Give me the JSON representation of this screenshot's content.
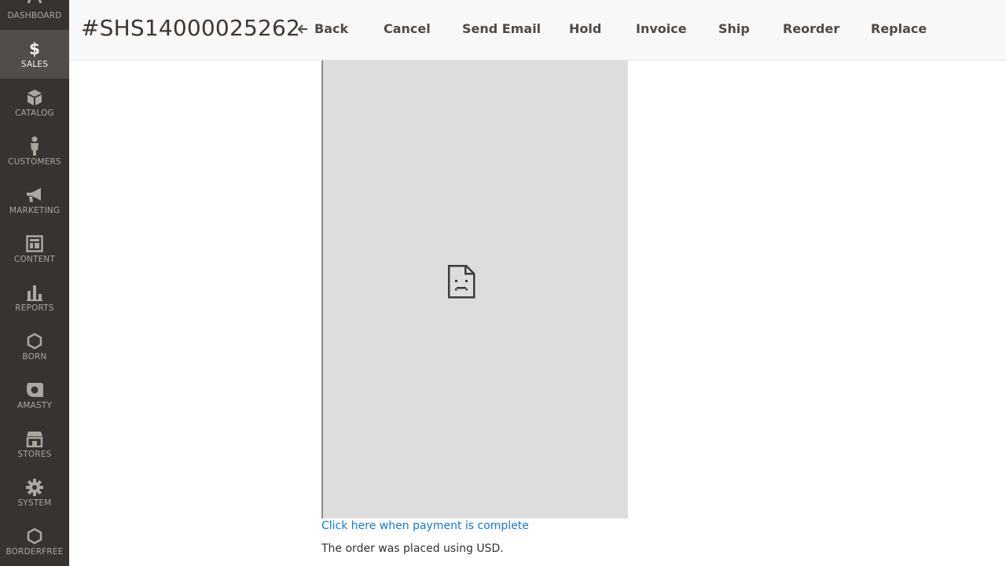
{
  "sidebar": {
    "items": [
      {
        "label": "DASHBOARD",
        "icon": "dashboard-icon",
        "active": false
      },
      {
        "label": "SALES",
        "icon": "dollar-icon",
        "active": true
      },
      {
        "label": "CATALOG",
        "icon": "cube-icon",
        "active": false
      },
      {
        "label": "CUSTOMERS",
        "icon": "person-icon",
        "active": false
      },
      {
        "label": "MARKETING",
        "icon": "megaphone-icon",
        "active": false
      },
      {
        "label": "CONTENT",
        "icon": "layout-icon",
        "active": false
      },
      {
        "label": "REPORTS",
        "icon": "bar-chart-icon",
        "active": false
      },
      {
        "label": "BORN",
        "icon": "hexagon-icon",
        "active": false
      },
      {
        "label": "AMASTY",
        "icon": "amasty-logo-icon",
        "active": false
      },
      {
        "label": "STORES",
        "icon": "storefront-icon",
        "active": false
      },
      {
        "label": "SYSTEM",
        "icon": "gear-icon",
        "active": false
      },
      {
        "label": "BORDERFREE",
        "icon": "hexagon-icon",
        "active": false
      }
    ]
  },
  "header": {
    "order_title": "#SHS14000025262",
    "buttons": {
      "back": "Back",
      "cancel": "Cancel",
      "send_email": "Send Email",
      "hold": "Hold",
      "invoice": "Invoice",
      "ship": "Ship",
      "reorder": "Reorder",
      "replace": "Replace"
    }
  },
  "content": {
    "payment_link": "Click here when payment is complete",
    "currency_note": "The order was placed using USD.",
    "frame_icon": "broken-page-icon"
  },
  "colors": {
    "sidebar_bg": "#373330",
    "sidebar_active": "#524d49",
    "link": "#1979c3",
    "frame_bg": "#dddddd"
  }
}
